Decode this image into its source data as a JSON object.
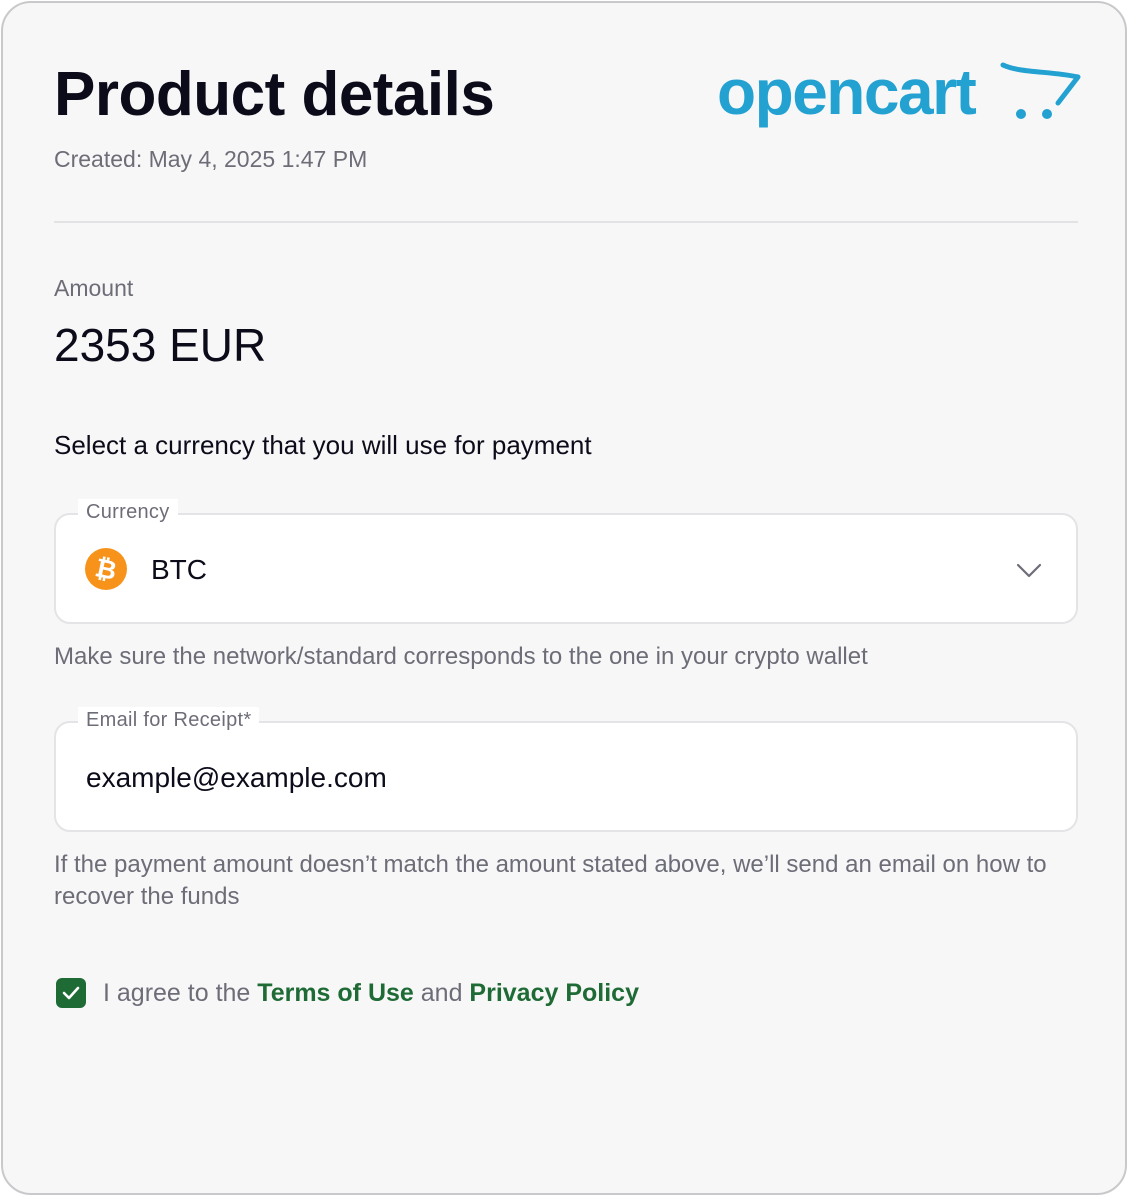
{
  "header": {
    "title": "Product details",
    "created": "Created: May 4, 2025 1:47 PM",
    "logo_text": "opencart",
    "logo_color": "#23a1d1"
  },
  "amount": {
    "label": "Amount",
    "value": "2353 EUR"
  },
  "currency_prompt": "Select a currency that you will use for payment",
  "currency_field": {
    "label": "Currency",
    "selected": "BTC",
    "icon": "bitcoin-icon",
    "icon_color": "#f7931a",
    "hint": "Make sure the network/standard corresponds to the one in your crypto wallet"
  },
  "email_field": {
    "label": "Email for Receipt*",
    "value": "example@example.com",
    "hint": "If the payment amount doesn’t match the amount stated above, we’ll send an email on how to recover the funds"
  },
  "agreement": {
    "checked": true,
    "prefix": "I agree to the ",
    "terms_link": "Terms of Use",
    "middle": " and ",
    "privacy_link": "Privacy Policy",
    "accent_color": "#1f6b35"
  }
}
